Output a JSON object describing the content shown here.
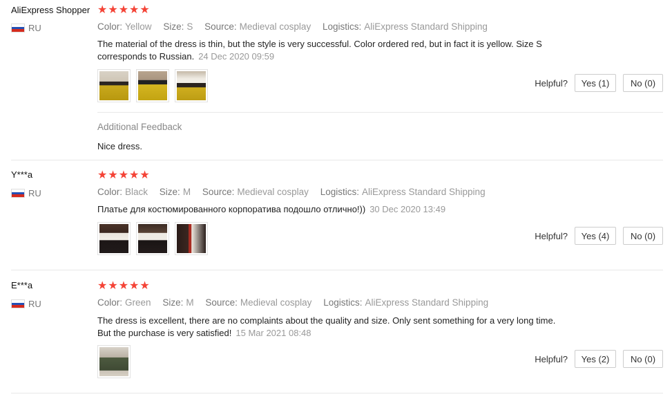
{
  "labels": {
    "color": "Color:",
    "size": "Size:",
    "source": "Source:",
    "logistics": "Logistics:",
    "helpful": "Helpful?",
    "additional_feedback": "Additional Feedback"
  },
  "icons": {
    "star": "star-icon",
    "flag": "russia-flag-icon"
  },
  "colors": {
    "star": "#f44336",
    "meta_text": "#999999"
  },
  "reviews": [
    {
      "user": "AliExpress Shopper",
      "country": "RU",
      "rating": 5,
      "stars": "★★★★★",
      "color": "Yellow",
      "size": "S",
      "source": "Medieval cosplay",
      "logistics": "AliExpress Standard Shipping",
      "text": "The material of the dress is thin, but the style is very successful. Color ordered red, but in fact it is yellow. Size S corresponds to Russian.",
      "date": "24 Dec 2020 09:59",
      "yes": "Yes (1)",
      "no": "No (0)",
      "additional_feedback": "Nice dress."
    },
    {
      "user": "Y***a",
      "country": "RU",
      "rating": 5,
      "stars": "★★★★★",
      "color": "Black",
      "size": "M",
      "source": "Medieval cosplay",
      "logistics": "AliExpress Standard Shipping",
      "text": "Платье для костюмированного корпоратива подошло отлично!))",
      "date": "30 Dec 2020 13:49",
      "yes": "Yes (4)",
      "no": "No (0)"
    },
    {
      "user": "E***a",
      "country": "RU",
      "rating": 5,
      "stars": "★★★★★",
      "color": "Green",
      "size": "M",
      "source": "Medieval cosplay",
      "logistics": "AliExpress Standard Shipping",
      "text_line1": "The dress is excellent, there are no complaints about the quality and size. Only sent something for a very long time.",
      "text_line2": "But the purchase is very satisfied!",
      "date": "15 Mar 2021 08:48",
      "yes": "Yes (2)",
      "no": "No (0)"
    }
  ]
}
